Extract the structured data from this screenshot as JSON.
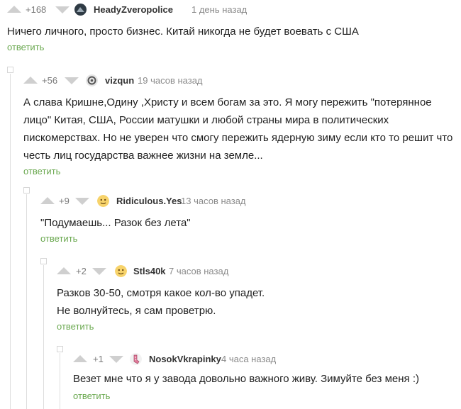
{
  "comments": [
    {
      "score": "+168",
      "author": "HeadyZveropolice",
      "time": "1 день назад",
      "text": "Ничего личного, просто бизнес. Китай никогда не будет воевать с США",
      "reply": "ответить",
      "avatar_icon": "dark-avatar-icon"
    },
    {
      "score": "+56",
      "author": "vizqun",
      "time": "19 часов назад",
      "text": "А слава Кришне,Одину ,Христу и всем богам за это. Я могу пережить \"потерянное лицо\" Китая, США, России матушки и любой страны мира в политических пискомерствах. Но не уверен что смогу пережить ядерную зиму если кто то решит что честь лиц государства важнее жизни на земле...",
      "reply": "ответить",
      "avatar_icon": "gray-avatar-icon"
    },
    {
      "score": "+9",
      "author": "Ridiculous.Yes",
      "time": "13 часов назад",
      "text": "\"Подумаешь... Разок без лета\"",
      "reply": "ответить",
      "avatar_icon": "yellow-face-avatar-icon"
    },
    {
      "score": "+2",
      "author": "Stls40k",
      "time": "7 часов назад",
      "text": "Разков 30-50, смотря какое кол-во упадет.\nНе волнуйтесь, я сам проветрю.",
      "reply": "ответить",
      "avatar_icon": "yellow-face-avatar-icon"
    },
    {
      "score": "+1",
      "author": "NosokVkrapinky",
      "time": "4 часа назад",
      "text": "Везет мне что я у завода довольно важного живу. Зимуйте без меня :)",
      "reply": "ответить",
      "avatar_icon": "sock-avatar-icon"
    }
  ],
  "colors": {
    "reply_link": "#6aa84f",
    "vote_arrow": "#cfcfcf",
    "branch_line": "#dedede"
  }
}
